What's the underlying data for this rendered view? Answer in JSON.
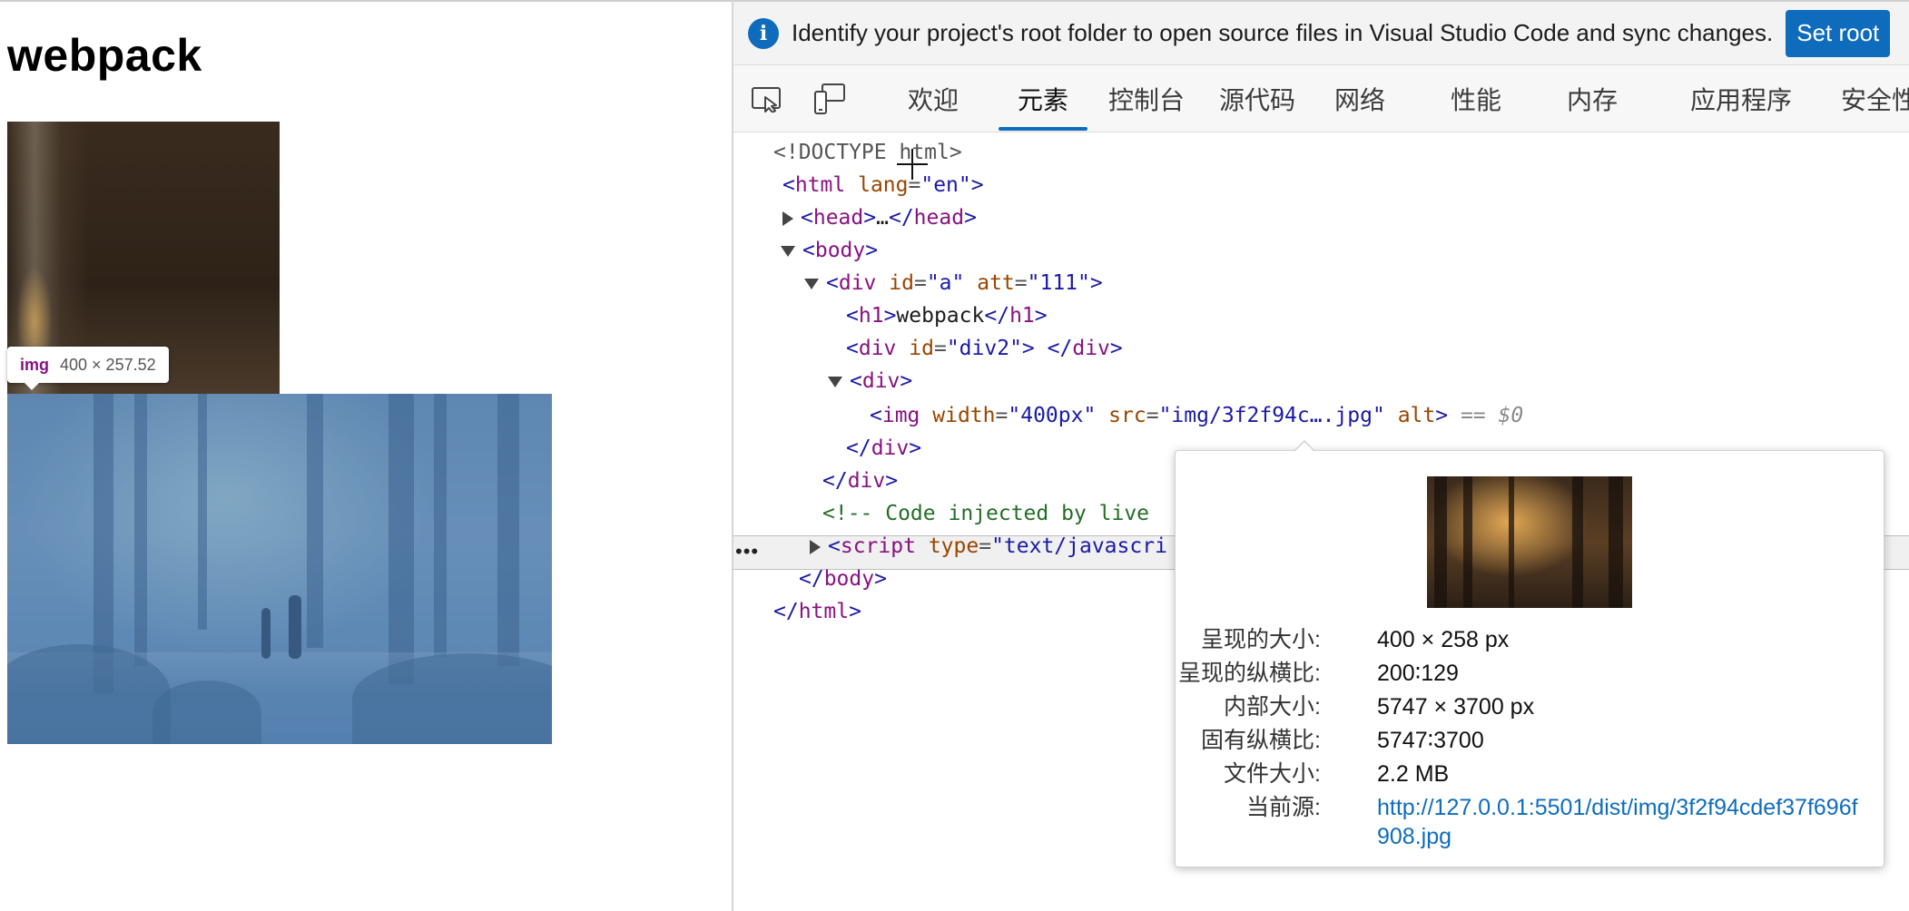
{
  "page": {
    "heading": "webpack",
    "tooltip": {
      "tag": "img",
      "dims": "400 × 257.52"
    }
  },
  "devtools": {
    "infobar": {
      "message": "Identify your project's root folder to open source files in Visual Studio Code and sync changes.",
      "button_label": "Set root"
    },
    "tabs": [
      {
        "label": "欢迎"
      },
      {
        "label": "元素"
      },
      {
        "label": "控制台"
      },
      {
        "label": "源代码"
      },
      {
        "label": "网络"
      },
      {
        "label": "性能"
      },
      {
        "label": "内存"
      },
      {
        "label": "应用程序"
      },
      {
        "label": "安全性"
      }
    ],
    "active_tab": "元素",
    "dom": {
      "doctype": "<!DOCTYPE html>",
      "html_tag": "html",
      "lang_attr": "lang",
      "lang_val": "\"en\"",
      "head_tag": "head",
      "head_ellipsis": "…",
      "body_tag": "body",
      "div_tag": "div",
      "id_attr": "id",
      "id_a_val": "\"a\"",
      "att_attr": "att",
      "att_val": "\"111\"",
      "h1_tag": "h1",
      "h1_text": "webpack",
      "div2_val": "\"div2\"",
      "div2_space": " ",
      "img_tag": "img",
      "width_attr": "width",
      "width_val": "\"400px\"",
      "src_attr": "src",
      "src_val": "\"img/3f2f94c….jpg\"",
      "alt_attr": "alt",
      "dollar": "== $0",
      "comment": "<!-- Code injected by live",
      "script_tag": "script",
      "type_attr": "type",
      "type_val": "\"text/javascri",
      "selected_ellipsis": "•••"
    },
    "preview": {
      "rows": [
        {
          "label": "呈现的大小:",
          "value": "400 × 258 px"
        },
        {
          "label": "呈现的纵横比:",
          "value": "200∶129"
        },
        {
          "label": "内部大小:",
          "value": "5747 × 3700 px"
        },
        {
          "label": "固有纵横比:",
          "value": "5747∶3700"
        },
        {
          "label": "文件大小:",
          "value": "2.2 MB"
        }
      ],
      "source_label": "当前源:",
      "source_url": "http://127.0.0.1:5501/dist/img/3f2f94cdef37f696f908.jpg"
    }
  }
}
